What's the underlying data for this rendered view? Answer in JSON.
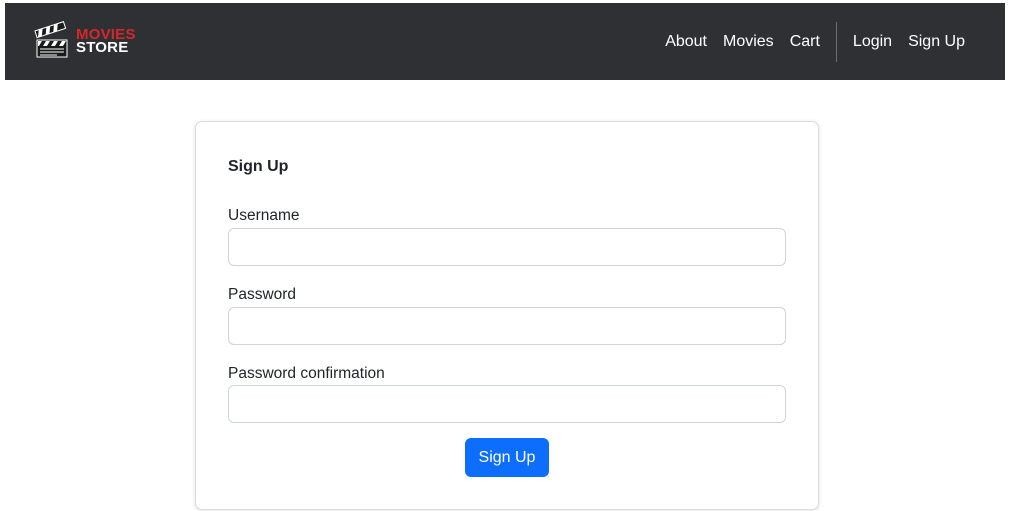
{
  "brand": {
    "line1": "MOVIES",
    "line2": "STORE",
    "icon": "clapperboard-icon",
    "accent_color": "#d4282b"
  },
  "nav": {
    "about": "About",
    "movies": "Movies",
    "cart": "Cart",
    "login": "Login",
    "signup": "Sign Up",
    "background_color": "#2f3033"
  },
  "form": {
    "title": "Sign Up",
    "username_label": "Username",
    "username_value": "",
    "password_label": "Password",
    "password_value": "",
    "password_confirmation_label": "Password confirmation",
    "password_confirmation_value": "",
    "submit_label": "Sign Up",
    "submit_color": "#0d6efd"
  }
}
